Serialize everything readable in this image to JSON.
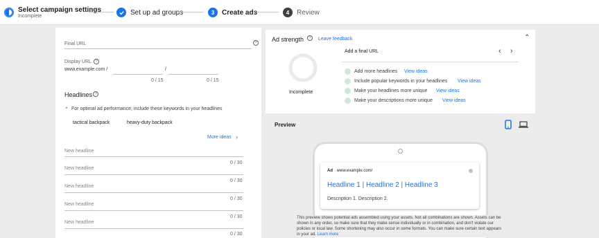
{
  "stepper": {
    "steps": [
      {
        "label": "Select campaign settings",
        "sub": "Incomplete"
      },
      {
        "label": "Set up ad groups"
      },
      {
        "label": "Create ads",
        "number": "3"
      },
      {
        "label": "Review",
        "number": "4"
      }
    ]
  },
  "form": {
    "final_url_placeholder": "Final URL",
    "display_url_label": "Display URL",
    "display_url_value": "www.example.com /",
    "display_url_sep": "/",
    "path1_counter": "0 / 15",
    "path2_counter": "0 / 15",
    "headlines_title": "Headlines",
    "keywords_hint": "For optimal ad performance, include these keywords in your headlines",
    "keywords": [
      "tactical backpack",
      "heavy-duty backpack"
    ],
    "more_ideas": "More ideas",
    "headlines": [
      {
        "placeholder": "New headline",
        "counter": "0 / 30"
      },
      {
        "placeholder": "New headline",
        "counter": "0 / 30"
      },
      {
        "placeholder": "New headline",
        "counter": "0 / 30"
      },
      {
        "placeholder": "New headline",
        "counter": "0 / 30"
      },
      {
        "placeholder": "New headline",
        "counter": "0 / 30"
      }
    ]
  },
  "strength": {
    "title": "Ad strength",
    "feedback": "Leave feedback",
    "status": "Incomplete",
    "add_final_url": "Add a final URL",
    "suggestions": [
      {
        "text": "Add more headlines",
        "link": "View ideas"
      },
      {
        "text": "Include popular keywords in your headlines",
        "link": "View ideas"
      },
      {
        "text": "Make your headlines more unique",
        "link": "View ideas"
      },
      {
        "text": "Make your descriptions more unique",
        "link": "View ideas"
      }
    ]
  },
  "preview": {
    "title": "Preview",
    "ad_badge": "Ad",
    "ad_url": "· www.example.com/",
    "ad_headline": "Headline 1 | Headline 2 | Headline 3",
    "ad_description": "Description 1. Description 2.",
    "disclaimer": "This preview shows potential ads assembled using your assets. Not all combinations are shown. Assets can be shown in any order, so make sure that they make sense individually or in combination, and don't violate our policies or local law. Some shortening may also occur in some formats. You can make sure certain text appears in your ad.",
    "learn_more": "Learn more"
  },
  "colors": {
    "accent": "#1a73e8",
    "dark_step": "#3c4043",
    "suggestion_dot": "#ceead6"
  }
}
